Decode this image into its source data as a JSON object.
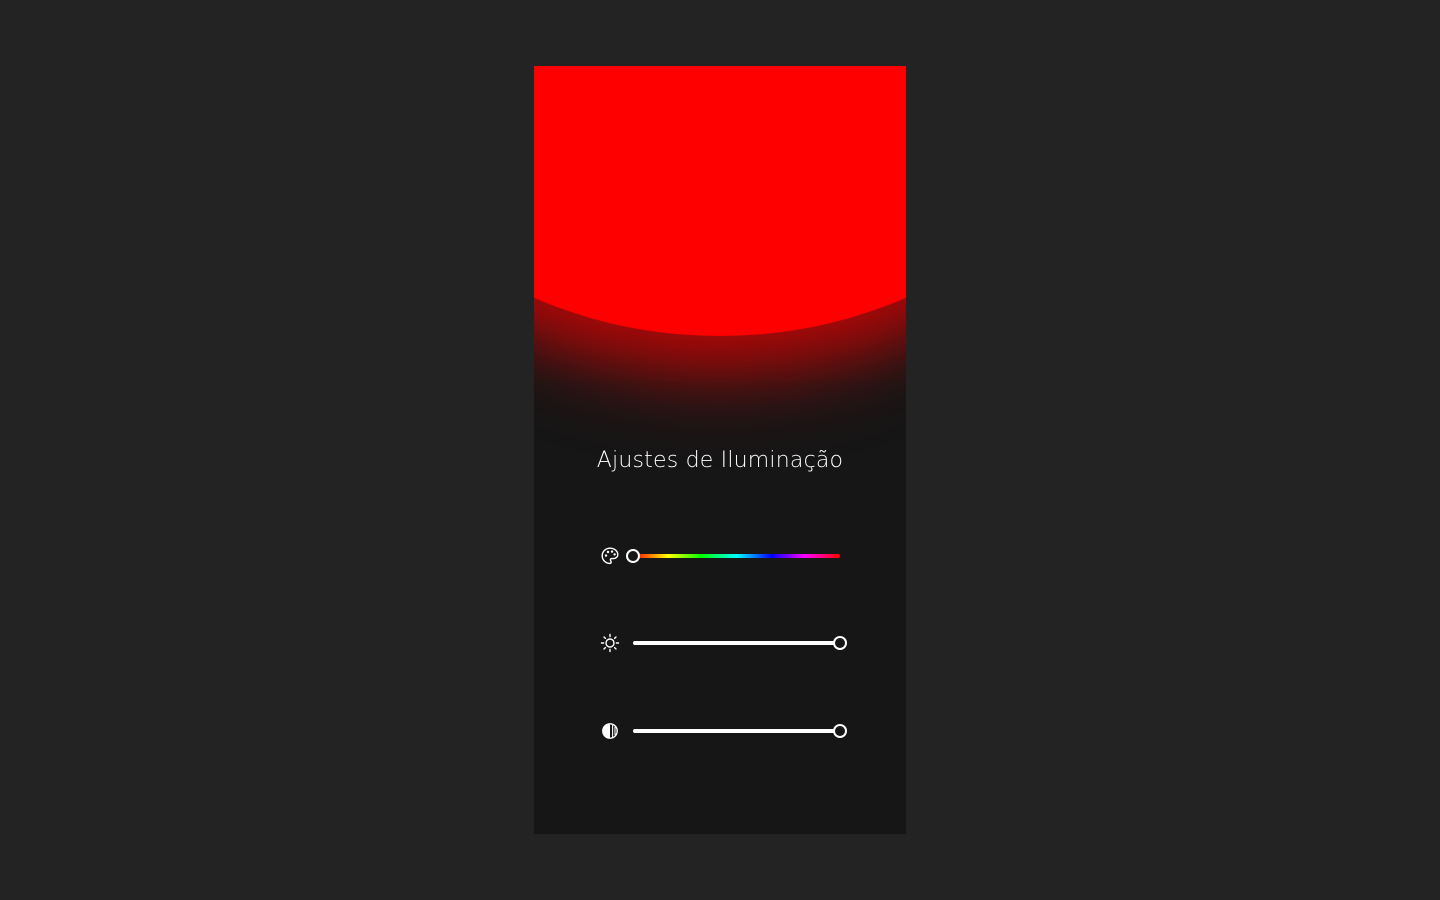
{
  "panel": {
    "title": "Ajustes de Iluminação",
    "light_color": "#ff0000"
  },
  "controls": [
    {
      "name": "hue",
      "icon": "palette-icon",
      "value": 0.0
    },
    {
      "name": "brightness",
      "icon": "sun-icon",
      "value": 1.0
    },
    {
      "name": "contrast",
      "icon": "contrast-icon",
      "value": 1.0
    }
  ]
}
